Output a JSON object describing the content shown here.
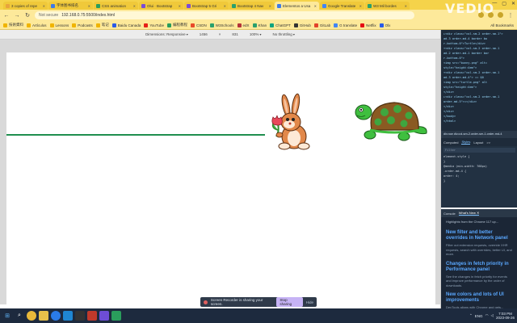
{
  "browser": {
    "tabs": [
      {
        "label": "3 copies of repe",
        "color": "#e8a33d"
      },
      {
        "label": "字体图书排名",
        "color": "#3d7be8"
      },
      {
        "label": "CSS animation",
        "color": "#2a9d5c"
      },
      {
        "label": "Olui · Bootstrap",
        "color": "#7a4dd6"
      },
      {
        "label": "Bootstrap 5 Gri",
        "color": "#7a4dd6"
      },
      {
        "label": "Bootstrap 4 Nav",
        "color": "#2aa06d"
      },
      {
        "label": "Elementos a Usa",
        "color": "#3d7be8",
        "active": true
      },
      {
        "label": "Google Translate",
        "color": "#4285f4"
      },
      {
        "label": "W3 Mil bordes",
        "color": "#2aa06d"
      }
    ],
    "window_controls": {
      "minimize": "—",
      "maximize": "▢",
      "close": "✕"
    },
    "address": {
      "security_label": "Not secure",
      "url": "192.168.0.75:5500/index.html"
    },
    "bookmarks": [
      {
        "label": "技術資料",
        "color": "#f0b400"
      },
      {
        "label": "Artículos",
        "color": "#f0b400"
      },
      {
        "label": "Lessons",
        "color": "#f0b400"
      },
      {
        "label": "Podcasts",
        "color": "#f0b400"
      },
      {
        "label": "笔记",
        "color": "#f0b400"
      },
      {
        "label": "Baidu Canada",
        "color": "#2a5be8"
      },
      {
        "label": "YouTube",
        "color": "#e62117"
      },
      {
        "label": "编程教程",
        "color": "#2a9d5c"
      },
      {
        "label": "CSDN",
        "color": "#e84a2a"
      },
      {
        "label": "W3Schools",
        "color": "#2aa06d"
      },
      {
        "label": "edX",
        "color": "#b4343a"
      },
      {
        "label": "Khan",
        "color": "#2aa06d"
      },
      {
        "label": "ChatGPT",
        "color": "#10a37f"
      },
      {
        "label": "GitHub",
        "color": "#333333"
      },
      {
        "label": "GitLab",
        "color": "#e2432a"
      },
      {
        "label": "G translate",
        "color": "#4285f4"
      },
      {
        "label": "Netflix",
        "color": "#e50914"
      },
      {
        "label": "Olx",
        "color": "#2a5be8"
      }
    ],
    "all_bookmarks_label": "All Bookmarks"
  },
  "device_toolbar": {
    "device": "Dimensions: Responsive",
    "width": "1456",
    "times": "×",
    "height": "831",
    "zoom": "100%",
    "throttle": "No throttling"
  },
  "devtools": {
    "elements_lines": [
      "▸<div class=\"col-sm-2 order-sm-1\">",
      "  ad-3 order-md-4 border bo",
      "  r-bottom-0\">Turtle</div>",
      "▾<div class=\"col-sm-2 order-sm-1",
      "  ad-2 order-md-1 border bor",
      "  r-bottom-0\">",
      "  <img src=\"bunny.png\" alt=",
      "   style=\"height:4em\">",
      "▾<div class=\"col-sm-2 order-sm-1",
      "  ad-3 order-md-4\"> == $0",
      "  <img src=\"turtle.png\" alt",
      "   style=\"height:4em\">",
      "  </div>",
      "▸<div class=\"col-sm-2 order-sm-1",
      "  order-md-5\">=</div>",
      "  </div>",
      "</div>",
      "</body>",
      "</html>"
    ],
    "breadcrumb": "div.row  div.col-sm-2.order-sm-1.order-md-4",
    "styles_tabs": [
      "Computed",
      "Styles",
      "Layout",
      ">>"
    ],
    "styles_filter": "Filter",
    "styles_lines": [
      "element.style {",
      "}",
      "@media (min-width: 768px)",
      ".order-md-4 {",
      "  order: 4;",
      "}"
    ],
    "drawer_tabs": [
      "Console",
      "What's New ✕"
    ],
    "whatsnew_highlight": "Highlights from the Chrome 117 up...",
    "features": [
      {
        "title": "New filter and better overrides in Network panel",
        "desc": "Filter out extension requests, override XHR requests, search with overrides, better UI, and more."
      },
      {
        "title": "Changes in fetch priority in Performance panel",
        "desc": "See the changes in fetch priority for events and improve performance by the order of downloads."
      },
      {
        "title": "New colors and lots of UI improvements",
        "desc": "DevTools aligns with Chrome and gets..."
      }
    ]
  },
  "recorder": {
    "message": "Screen Recorder is sharing your screen.",
    "stop_label": "Stop sharing",
    "hide_label": "Hide"
  },
  "taskbar": {
    "start_icon": "windows-icon",
    "time": "7:03 PM",
    "date": "2023-09-26",
    "tray_lang": "ENG"
  },
  "watermark": "VEDIO"
}
